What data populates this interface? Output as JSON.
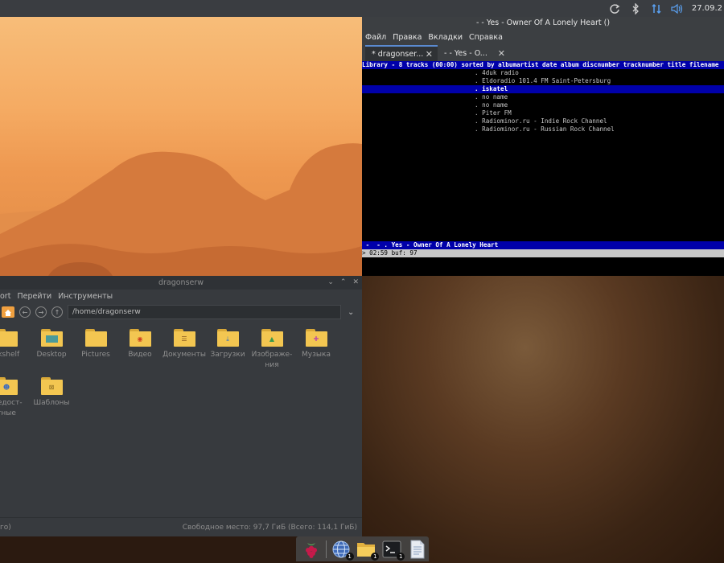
{
  "top_panel": {
    "clock": "27.09.2",
    "tray_icons": [
      "sync-icon",
      "bluetooth-icon",
      "network-icon",
      "volume-icon"
    ]
  },
  "terminal": {
    "title": "- - Yes - Owner Of A Lonely Heart ()",
    "menu": [
      "Файл",
      "Правка",
      "Вкладки",
      "Справка"
    ],
    "tabs": [
      {
        "label": "* dragonser..."
      },
      {
        "label": "- - Yes - O..."
      }
    ],
    "library_header": "Library - 8 tracks (00:00) sorted by albumartist date album discnumber tracknumber title filename",
    "tracks": [
      ". 4duk radio",
      ". Eldoradio 101.4 FM Saint-Petersburg",
      ". iskatel",
      ". no name",
      ". no name",
      ". Piter FM",
      ". Radiominor.ru - Indie Rock Channel",
      ". Radiominor.ru - Russian Rock Channel"
    ],
    "selected_index": 2,
    "now_playing": " -  - . Yes - Owner Of A Lonely Heart",
    "status": "> 02:59 buf: 97"
  },
  "file_manager": {
    "title": "dragonserw",
    "menu": [
      "ort",
      "Перейти",
      "Инструменты"
    ],
    "path": "/home/dragonserw",
    "items_row1": [
      {
        "label": "okshelf",
        "emblem": "",
        "icon": "folder-icon"
      },
      {
        "label": "Desktop",
        "emblem": "desktop",
        "icon": "desktop-folder-icon"
      },
      {
        "label": "Pictures",
        "emblem": "",
        "icon": "folder-icon"
      },
      {
        "label": "Видео",
        "emblem": "video",
        "icon": "video-folder-icon"
      },
      {
        "label": "Документы",
        "emblem": "docs",
        "icon": "documents-folder-icon"
      },
      {
        "label": "Загрузки",
        "emblem": "download",
        "icon": "downloads-folder-icon"
      },
      {
        "label": "Изображе-\nния",
        "emblem": "image",
        "icon": "images-folder-icon"
      },
      {
        "label": "Музыка",
        "emblem": "music",
        "icon": "music-folder-icon"
      }
    ],
    "items_row2": [
      {
        "label": "щедост-\nтные",
        "emblem": "users",
        "icon": "public-folder-icon"
      },
      {
        "label": "Шаблоны",
        "emblem": "template",
        "icon": "templates-folder-icon"
      }
    ],
    "status_left": "го)",
    "status_right": "Свободное место: 97,7 ГиБ (Всего: 114,1 ГиБ)"
  },
  "dock": {
    "items": [
      {
        "name": "raspberry-menu-icon",
        "badge": ""
      },
      {
        "name": "browser-icon",
        "badge": "1"
      },
      {
        "name": "file-manager-icon",
        "badge": "1"
      },
      {
        "name": "terminal-icon",
        "badge": "1"
      },
      {
        "name": "text-editor-icon",
        "badge": ""
      }
    ]
  }
}
